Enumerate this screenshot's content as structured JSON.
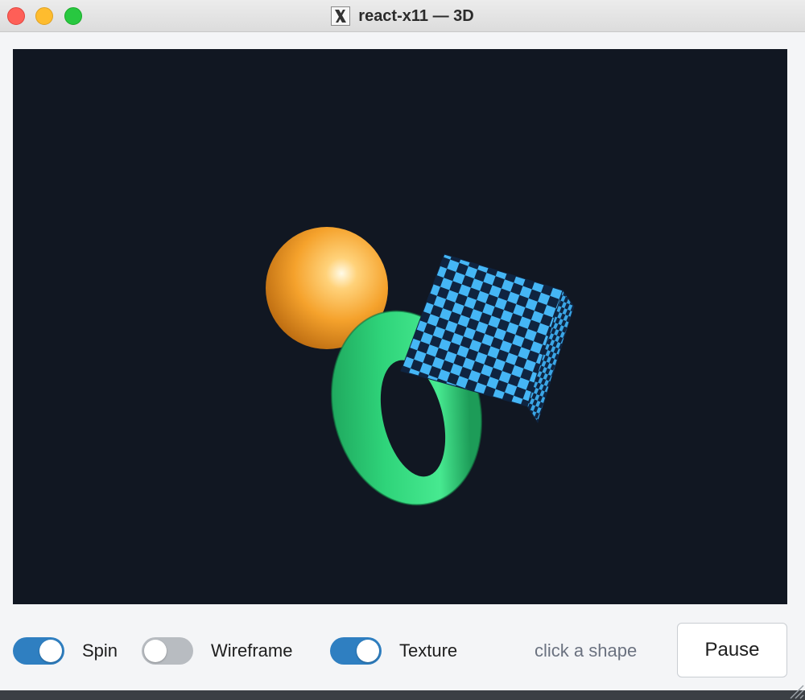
{
  "window": {
    "title": "react-x11 — 3D"
  },
  "scene": {
    "background": "#111722",
    "shapes": [
      {
        "name": "sphere",
        "color": "#f7a630"
      },
      {
        "name": "torus",
        "color": "#2fd47a"
      },
      {
        "name": "cube",
        "color": "#45b6f5",
        "pattern": "checkerboard",
        "pattern_dark": "#0f2440"
      }
    ]
  },
  "controls": {
    "toggles": [
      {
        "label": "Spin",
        "on": true
      },
      {
        "label": "Wireframe",
        "on": false
      },
      {
        "label": "Texture",
        "on": true
      }
    ],
    "status": "click a shape",
    "pause_label": "Pause"
  },
  "colors": {
    "toggle_on": "#2f7fc1",
    "toggle_off": "#b8bcc1"
  }
}
